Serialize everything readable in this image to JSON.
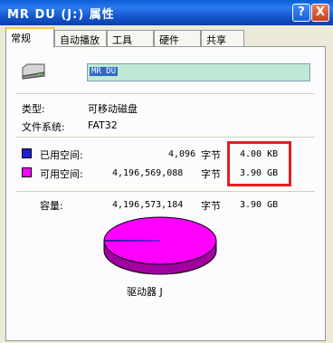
{
  "window": {
    "title": "MR DU (J:) 属性",
    "help_glyph": "?",
    "close_glyph": "X"
  },
  "tabs": [
    "常规",
    "自动播放",
    "工具",
    "硬件",
    "共享"
  ],
  "general": {
    "volume_label": "MR DU",
    "type_label": "类型:",
    "type_value": "可移动磁盘",
    "fs_label": "文件系统:",
    "fs_value": "FAT32",
    "used": {
      "label": "已用空间:",
      "bytes": "4,096",
      "unit": "字节",
      "size": "4.00 KB",
      "color": "#1c20d8"
    },
    "free": {
      "label": "可用空间:",
      "bytes": "4,196,569,088",
      "unit": "字节",
      "size": "3.90 GB",
      "color": "#ff00ff"
    },
    "capacity": {
      "label": "容量:",
      "bytes": "4,196,573,184",
      "unit": "字节",
      "size": "3.90 GB"
    },
    "drive_caption": "驱动器 J"
  }
}
